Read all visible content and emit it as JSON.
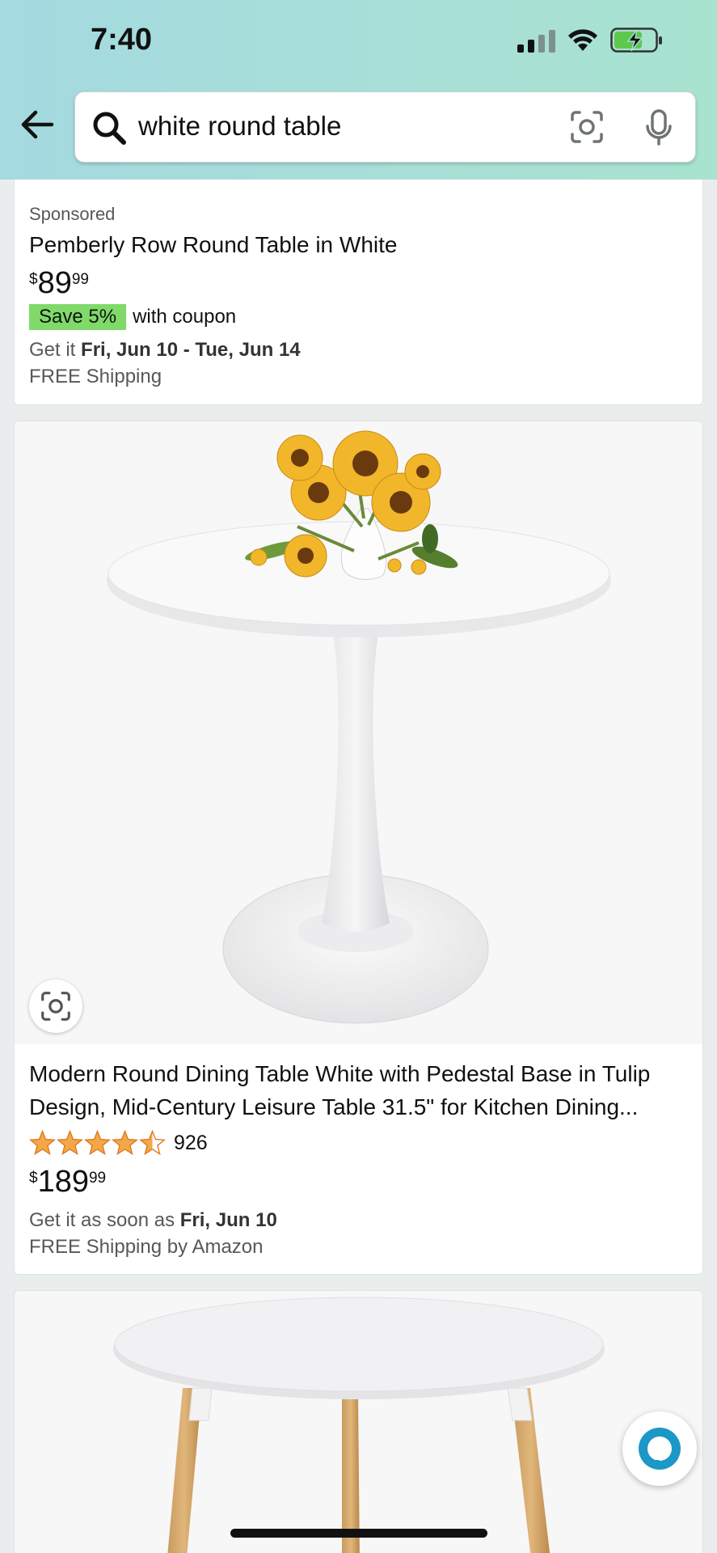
{
  "status_bar": {
    "time": "7:40",
    "icons": [
      "cellular-signal-icon",
      "wifi-icon",
      "battery-charging-icon"
    ]
  },
  "header": {
    "back_icon": "back-arrow-icon",
    "search": {
      "value": "white round table",
      "icons": [
        "search-icon",
        "camera-lens-icon",
        "microphone-icon"
      ]
    }
  },
  "results": [
    {
      "sponsored_label": "Sponsored",
      "title": "Pemberly Row Round Table in White",
      "price": {
        "symbol": "$",
        "whole": "89",
        "fraction": "99"
      },
      "coupon": {
        "badge": "Save 5%",
        "text": "with coupon"
      },
      "delivery": {
        "prefix": "Get it",
        "dates": "Fri, Jun 10 - Tue, Jun 14"
      },
      "shipping": "FREE Shipping"
    },
    {
      "title": "Modern Round Dining Table White with Pedestal Base in Tulip Design, Mid-Century Leisure Table 31.5\" for Kitchen Dining...",
      "rating": 4.5,
      "review_count": "926",
      "price": {
        "symbol": "$",
        "whole": "189",
        "fraction": "99"
      },
      "delivery": {
        "prefix": "Get it as soon as",
        "dates": "Fri, Jun 10"
      },
      "shipping": "FREE Shipping by Amazon"
    },
    {
      "image": "white-round-table-wooden-legs"
    }
  ],
  "colors": {
    "header_gradient_start": "#a4dae0",
    "header_gradient_end": "#a8e3cf",
    "coupon_badge": "#7fda69",
    "star": "#f3a847",
    "alexa": "#1b98c7"
  }
}
